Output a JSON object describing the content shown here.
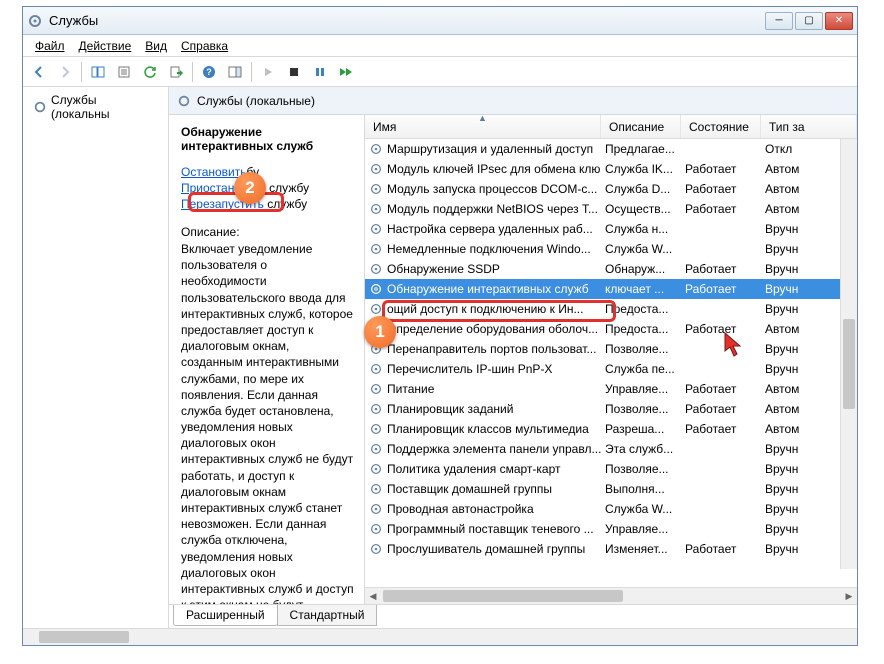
{
  "window": {
    "title": "Службы"
  },
  "menu": {
    "file": "Файл",
    "action": "Действие",
    "view": "Вид",
    "help": "Справка"
  },
  "sidebar": {
    "root": "Службы (локальны"
  },
  "mainHead": "Службы (локальные)",
  "detail": {
    "name": "Обнаружение интерактивных служб",
    "stop": "Остановить",
    "stopSuffix": "бу",
    "pause": "Приостановить",
    "pauseSuffix": " службу",
    "restart": "Перезапустить",
    "restartSuffix": " службу",
    "descLabel": "Описание:",
    "desc": "Включает уведомление пользователя о необходимости пользовательского ввода для интерактивных служб, которое предоставляет доступ к диалоговым окнам, созданным интерактивными службами, по мере их появления. Если данная служба будет остановлена, уведомления новых диалоговых окон интерактивных служб не будут работать, и доступ к диалоговым окнам интерактивных служб станет невозможен. Если данная служба отключена, уведомления новых диалоговых окон интерактивных служб и доступ к этим окнам не будут работать"
  },
  "columns": {
    "name": "Имя",
    "desc": "Описание",
    "status": "Состояние",
    "type": "Тип за"
  },
  "services": [
    {
      "n": "Маршрутизация и удаленный доступ",
      "d": "Предлагае...",
      "s": "",
      "t": "Откл"
    },
    {
      "n": "Модуль ключей IPsec для обмена клю...",
      "d": "Служба IK...",
      "s": "Работает",
      "t": "Автом"
    },
    {
      "n": "Модуль запуска процессов DCOM-с...",
      "d": "Служба D...",
      "s": "Работает",
      "t": "Автом"
    },
    {
      "n": "Модуль поддержки NetBIOS через T...",
      "d": "Осуществ...",
      "s": "Работает",
      "t": "Автом"
    },
    {
      "n": "Настройка сервера удаленных раб...",
      "d": "Служба н...",
      "s": "",
      "t": "Вручн"
    },
    {
      "n": "Немедленные подключения Windo...",
      "d": "Служба W...",
      "s": "",
      "t": "Вручн"
    },
    {
      "n": "Обнаружение SSDP",
      "d": "Обнаруж...",
      "s": "Работает",
      "t": "Вручн"
    },
    {
      "n": "Обнаружение интерактивных служб",
      "d": "ключает ...",
      "s": "Работает",
      "t": "Вручн",
      "sel": true
    },
    {
      "n": "ощий доступ к подключению к Ин...",
      "d": "Предоста...",
      "s": "",
      "t": "Вручн"
    },
    {
      "n": "Определение оборудования оболоч...",
      "d": "Предоста...",
      "s": "Работает",
      "t": "Автом"
    },
    {
      "n": "Перенаправитель портов пользоват...",
      "d": "Позволяе...",
      "s": "",
      "t": "Вручн"
    },
    {
      "n": "Перечислитель IP-шин PnP-X",
      "d": "Служба пе...",
      "s": "",
      "t": "Вручн"
    },
    {
      "n": "Питание",
      "d": "Управляе...",
      "s": "Работает",
      "t": "Автом"
    },
    {
      "n": "Планировщик заданий",
      "d": "Позволяе...",
      "s": "Работает",
      "t": "Автом"
    },
    {
      "n": "Планировщик классов мультимедиа",
      "d": "Разреша...",
      "s": "Работает",
      "t": "Автом"
    },
    {
      "n": "Поддержка элемента панели управл...",
      "d": "Эта служб...",
      "s": "",
      "t": "Вручн"
    },
    {
      "n": "Политика удаления смарт-карт",
      "d": "Позволяе...",
      "s": "",
      "t": "Вручн"
    },
    {
      "n": "Поставщик домашней группы",
      "d": "Выполня...",
      "s": "",
      "t": "Вручн"
    },
    {
      "n": "Проводная автонастройка",
      "d": "Служба W...",
      "s": "",
      "t": "Вручн"
    },
    {
      "n": "Программный поставщик теневого ...",
      "d": "Управляе...",
      "s": "",
      "t": "Вручн"
    },
    {
      "n": "Прослушиватель домашней группы",
      "d": "Изменяет...",
      "s": "Работает",
      "t": "Вручн"
    }
  ],
  "tabs": {
    "extended": "Расширенный",
    "standard": "Стандартный"
  },
  "annotations": {
    "b1": "1",
    "b2": "2"
  }
}
